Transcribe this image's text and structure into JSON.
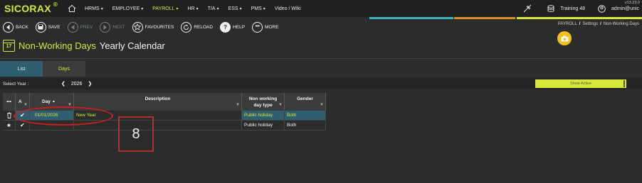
{
  "app": {
    "logo": "SICORAX",
    "logo_mark": "®",
    "version": "v13.23.0"
  },
  "nav": [
    {
      "label": "HRMS",
      "caret": true
    },
    {
      "label": "EMPLOYEE",
      "caret": true
    },
    {
      "label": "PAYROLL",
      "caret": true,
      "active": true
    },
    {
      "label": "HR",
      "caret": true
    },
    {
      "label": "T/A",
      "caret": true
    },
    {
      "label": "ESS",
      "caret": true
    },
    {
      "label": "PMS",
      "caret": true
    },
    {
      "label": "Video / Wiki",
      "caret": false
    }
  ],
  "top_right": {
    "database": "Training 48",
    "user": "admin@unic"
  },
  "toolbar": {
    "back": "BACK",
    "save": "SAVE",
    "prev": "PREV",
    "next": "NEXT",
    "favourites": "FAVOURITES",
    "reload": "RELOAD",
    "help": "HELP",
    "more": "MORE"
  },
  "breadcrumb": [
    "PAYROLL",
    "Settings",
    "Non-Working Days"
  ],
  "title": {
    "main": "Non-Working Days",
    "sub": "Yearly Calendar",
    "calendar_number": "17"
  },
  "tabs": [
    {
      "label": "List",
      "active": true
    },
    {
      "label": "Days",
      "active": false
    }
  ],
  "year": {
    "label": "Select Year :",
    "value": "2026"
  },
  "show_active": "Show Active",
  "grid": {
    "headers": {
      "menu": "•••",
      "active": "A",
      "day": "Day",
      "description": "Description",
      "non_working_type": "Non working day type",
      "gender": "Gender"
    },
    "rows": [
      {
        "active": true,
        "day": "01/01/2026",
        "description": "New Year",
        "type": "Public holiday",
        "gender": "Both"
      },
      {
        "active": true,
        "day": "",
        "description": "",
        "type": "Public holiday",
        "gender": "Both"
      }
    ]
  },
  "annotation": {
    "number": "8"
  },
  "colors": {
    "accent": "#d7e83a",
    "selected_row": "#2e5e70",
    "highlight": "#c81e1e",
    "badge": "#f4c21d"
  }
}
